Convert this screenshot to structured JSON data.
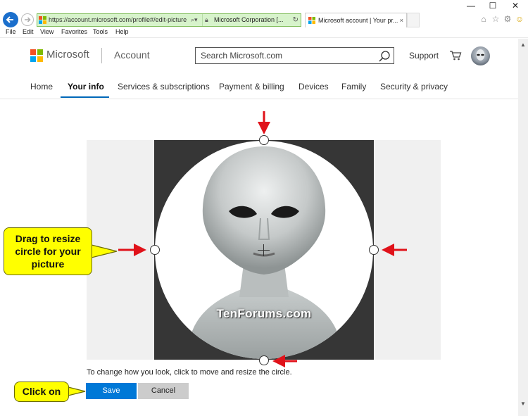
{
  "browser": {
    "window_buttons": {
      "minimize": "—",
      "maximize": "☐",
      "close": "✕"
    },
    "url": "https://account.microsoft.com/profile#/edit-picture",
    "cert": "Microsoft Corporation [...",
    "tab_title": "Microsoft account | Your pr...",
    "tab_close": "×",
    "menu": [
      "File",
      "Edit",
      "View",
      "Favorites",
      "Tools",
      "Help"
    ]
  },
  "header": {
    "brand": "Microsoft",
    "section": "Account",
    "search_placeholder": "Search Microsoft.com",
    "support": "Support",
    "tabs": [
      "Home",
      "Your info",
      "Services & subscriptions",
      "Payment & billing",
      "Devices",
      "Family",
      "Security & privacy"
    ],
    "active_tab": "Your info"
  },
  "editor": {
    "watermark": "TenForums.com",
    "instruction": "To change how you look, click to move and resize the circle.",
    "save": "Save",
    "cancel": "Cancel"
  },
  "annotations": {
    "resize_lines": [
      "Drag to resize",
      "circle for your",
      "picture"
    ],
    "click": "Click on"
  },
  "colors": {
    "accent": "#0078d7",
    "callout": "#ffff00",
    "arrow": "#e0121a",
    "address_bar_secure": "#d7f3cb"
  }
}
